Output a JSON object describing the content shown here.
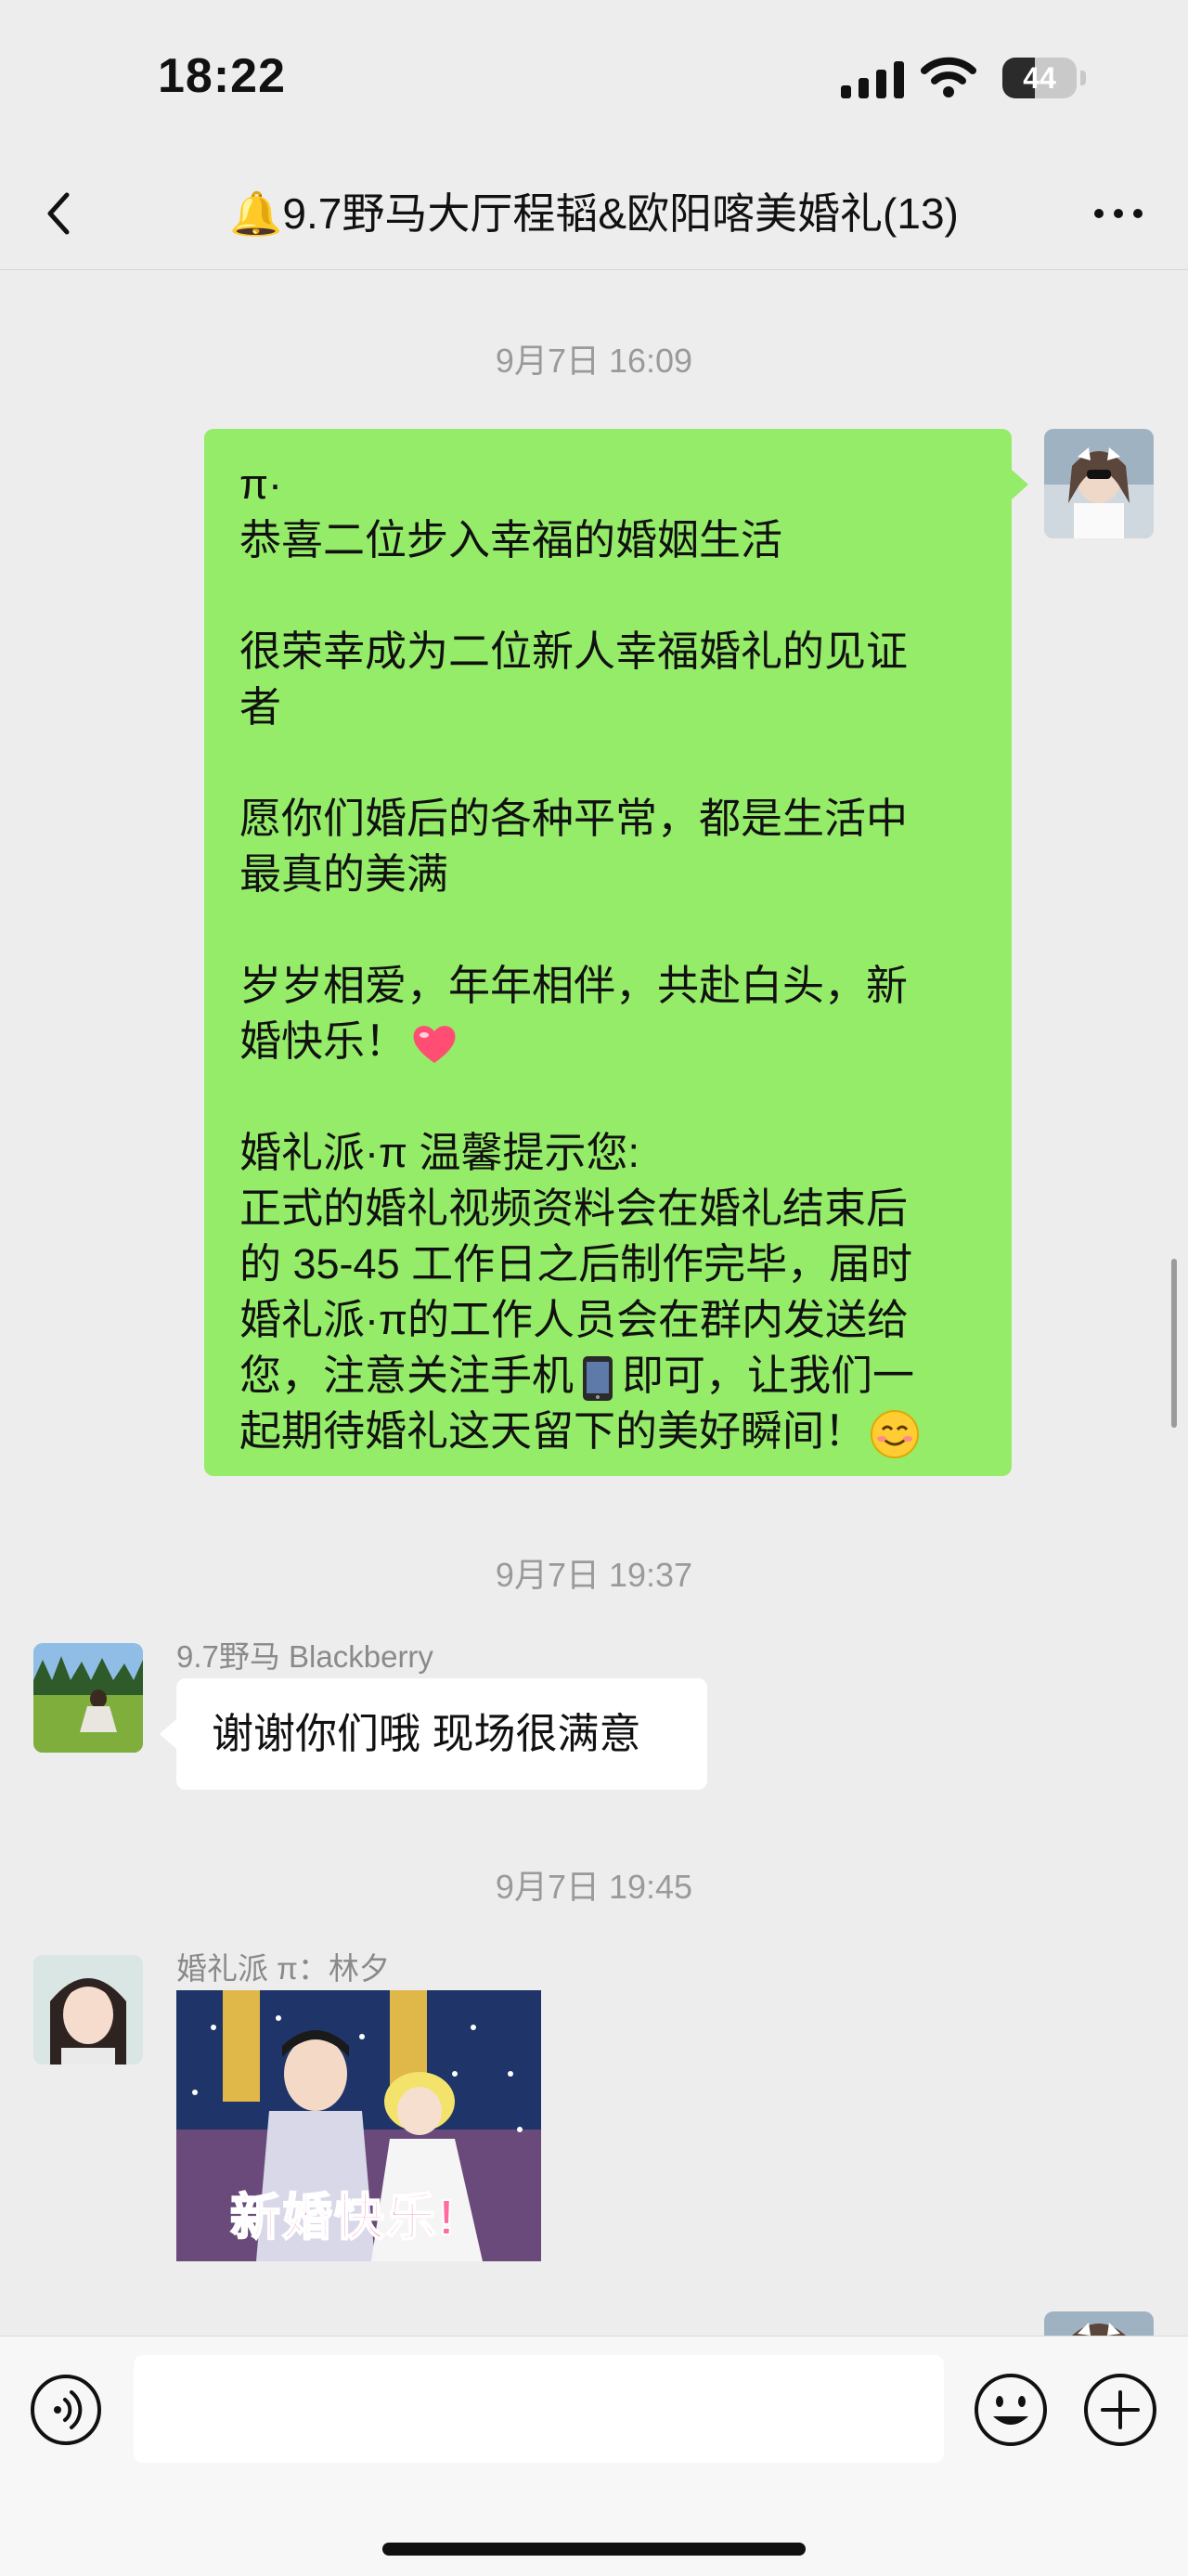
{
  "status_bar": {
    "time": "18:22",
    "battery": "44",
    "battery_level": 0.44
  },
  "nav": {
    "title": "🔔9.7野马大厅程韬&欧阳喀美婚礼(13)"
  },
  "messages": {
    "ts1": "9月7日 16:09",
    "outgoing_lines": [
      "π·",
      "恭喜二位步入幸福的婚姻生活",
      "",
      "很荣幸成为二位新人幸福婚礼的见证",
      "者",
      "",
      "愿你们婚后的各种平常，都是生活中",
      "最真的美满",
      "",
      "岁岁相爱，年年相伴，共赴白头，新",
      "婚快乐！",
      "",
      "婚礼派·π  温馨提示您:",
      "正式的婚礼视频资料会在婚礼结束后",
      "的 35-45 工作日之后制作完毕，届时",
      "婚礼派·π的工作人员会在群内发送给",
      "您，注意关注手机",
      "即可，让我们一",
      "起期待婚礼这天留下的美好瞬间！"
    ],
    "ts2": "9月7日 19:37",
    "sender1": "9.7野马 Blackberry",
    "reply1": "谢谢你们哦 现场很满意",
    "ts3": "9月7日 19:45",
    "sender2": "婚礼派 π：林夕",
    "sticker_text": "新婚快乐!"
  },
  "input": {
    "placeholder": ""
  },
  "colors": {
    "bg": "#ededed",
    "own_bubble": "#95ec69",
    "other_bubble": "#ffffff"
  },
  "icons": [
    "back-chevron-icon",
    "more-icon",
    "voice-icon",
    "emoji-icon",
    "plus-icon",
    "heart-icon",
    "phone-icon",
    "smile-icon"
  ]
}
